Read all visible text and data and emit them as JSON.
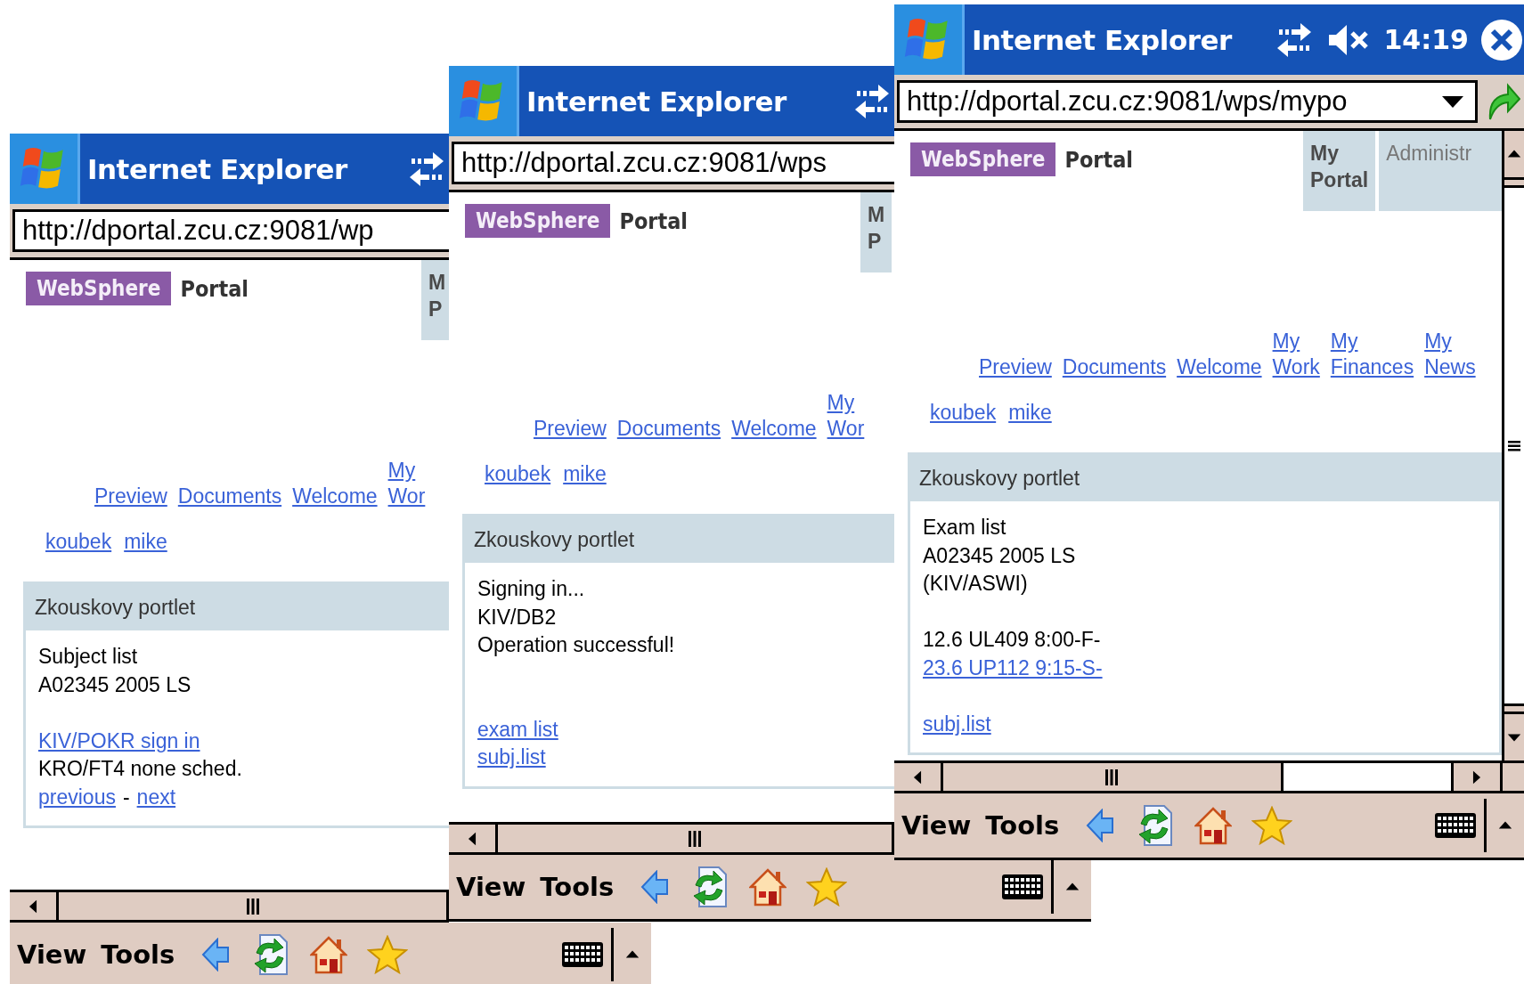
{
  "windows": [
    {
      "title_bar": {
        "title": "Internet Explorer",
        "status_icons": [
          {
            "kind": "sync"
          }
        ]
      },
      "address": {
        "url": "http://dportal.zcu.cz:9081/wp",
        "dropdown": false,
        "go_button": false
      },
      "logo": {
        "brand": "WebSphere",
        "product": "Portal"
      },
      "tabs": [
        {
          "label": "M P",
          "selected": true
        }
      ],
      "nav_links": [
        "Preview",
        "Documents",
        "Welcome",
        "My Wor"
      ],
      "user_links": [
        "koubek",
        "mike"
      ],
      "portlet": {
        "title": "Zkouskovy portlet",
        "lines": [
          {
            "kind": "text",
            "text": "Subject list"
          },
          {
            "kind": "text",
            "text": "A02345 2005 LS"
          },
          {
            "kind": "blank"
          },
          {
            "kind": "link",
            "text": "KIV/POKR sign in"
          },
          {
            "kind": "text",
            "text": "KRO/FT4 none sched."
          },
          {
            "kind": "parts",
            "parts": [
              {
                "text": "previous",
                "link": true
              },
              {
                "text": "-",
                "link": false
              },
              {
                "text": "next",
                "link": true
              }
            ]
          }
        ]
      },
      "vertical_scrollbar": false,
      "menu_bar": {
        "menus": [
          "View",
          "Tools"
        ]
      }
    },
    {
      "title_bar": {
        "title": "Internet Explorer",
        "status_icons": [
          {
            "kind": "sync"
          }
        ]
      },
      "address": {
        "url": "http://dportal.zcu.cz:9081/wps",
        "dropdown": false,
        "go_button": false
      },
      "logo": {
        "brand": "WebSphere",
        "product": "Portal"
      },
      "tabs": [
        {
          "label": "M P",
          "selected": true
        }
      ],
      "nav_links": [
        "Preview",
        "Documents",
        "Welcome",
        "My Wor"
      ],
      "user_links": [
        "koubek",
        "mike"
      ],
      "portlet": {
        "title": "Zkouskovy portlet",
        "lines": [
          {
            "kind": "text",
            "text": "Signing in..."
          },
          {
            "kind": "text",
            "text": "KIV/DB2"
          },
          {
            "kind": "text",
            "text": "Operation successful!"
          },
          {
            "kind": "blank"
          },
          {
            "kind": "blank"
          },
          {
            "kind": "link",
            "text": "exam list"
          },
          {
            "kind": "link",
            "text": "subj.list"
          }
        ]
      },
      "vertical_scrollbar": false,
      "menu_bar": {
        "menus": [
          "View",
          "Tools"
        ]
      }
    },
    {
      "title_bar": {
        "title": "Internet Explorer",
        "status_icons": [
          {
            "kind": "sync"
          },
          {
            "kind": "mute"
          }
        ],
        "clock": "14:19",
        "close_button": true
      },
      "address": {
        "url": "http://dportal.zcu.cz:9081/wps/mypo",
        "dropdown": true,
        "go_button": true
      },
      "logo": {
        "brand": "WebSphere",
        "product": "Portal"
      },
      "tabs": [
        {
          "label": "My Portal",
          "selected": true
        },
        {
          "label": "Administr",
          "selected": false
        }
      ],
      "nav_links": [
        "Preview",
        "Documents",
        "Welcome",
        "My Work",
        "My Finances",
        "My News"
      ],
      "user_links": [
        "koubek",
        "mike"
      ],
      "portlet": {
        "title": "Zkouskovy portlet",
        "lines": [
          {
            "kind": "text",
            "text": "Exam list"
          },
          {
            "kind": "text",
            "text": "A02345 2005 LS"
          },
          {
            "kind": "text",
            "text": "(KIV/ASWI)"
          },
          {
            "kind": "blank"
          },
          {
            "kind": "text",
            "text": "12.6 UL409 8:00-F-"
          },
          {
            "kind": "link",
            "text": "23.6 UP112 9:15-S-"
          },
          {
            "kind": "blank"
          },
          {
            "kind": "link",
            "text": "subj.list"
          }
        ]
      },
      "vertical_scrollbar": true,
      "menu_bar": {
        "menus": [
          "View",
          "Tools"
        ]
      }
    }
  ]
}
